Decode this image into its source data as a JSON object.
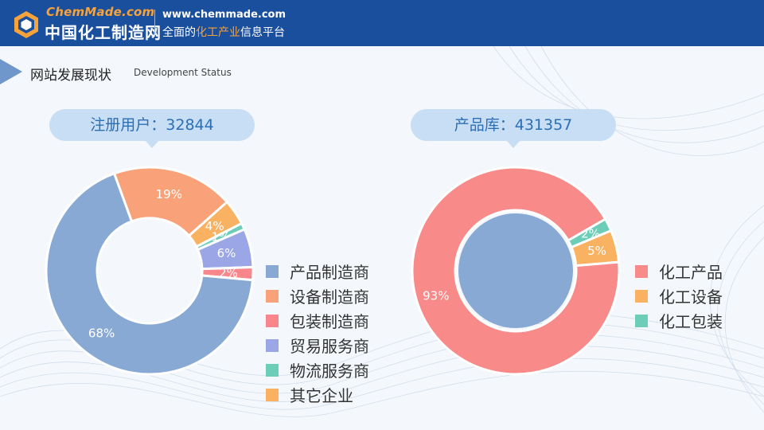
{
  "header": {
    "brand_en": "ChemMade.com",
    "brand_cn": "中国化工制造网",
    "url": "www.chemmade.com",
    "slogan_pre": "全面的",
    "slogan_highlight": "化工产业",
    "slogan_post": "信息平台",
    "bg_color": "#1a4f9e",
    "accent_color": "#f7a23a",
    "logo_icon": "hexagon-logo-icon"
  },
  "section": {
    "title": "网站发展现状",
    "subtitle": "Development Status"
  },
  "stats": {
    "users_label": "注册用户：32844",
    "products_label": "产品库：431357"
  },
  "chart_data": [
    {
      "type": "pie",
      "variant": "donut",
      "title": "注册用户：32844",
      "categories": [
        "产品制造商",
        "设备制造商",
        "包装制造商",
        "贸易服务商",
        "物流服务商",
        "其它企业"
      ],
      "values": [
        68,
        19,
        2,
        6,
        1,
        4
      ],
      "labels": [
        "68%",
        "19%",
        "2%",
        "6%",
        "1%",
        "4%"
      ],
      "colors": [
        "#87a9d3",
        "#f9a27a",
        "#f8868a",
        "#9aa6e6",
        "#6ccdb8",
        "#f9b262"
      ],
      "clockwise_order": [
        1,
        5,
        4,
        3,
        2,
        0
      ],
      "legend_position": "right"
    },
    {
      "type": "pie",
      "variant": "donut",
      "title": "产品库：431357",
      "categories": [
        "化工产品",
        "化工设备",
        "化工包装"
      ],
      "values": [
        93,
        5,
        2
      ],
      "labels": [
        "93%",
        "5%",
        "2%"
      ],
      "colors": [
        "#f98a8a",
        "#f9b262",
        "#6ccdb8"
      ],
      "clockwise_order": [
        2,
        1,
        0
      ],
      "legend_position": "right",
      "center_color": "#87a9d3"
    }
  ]
}
